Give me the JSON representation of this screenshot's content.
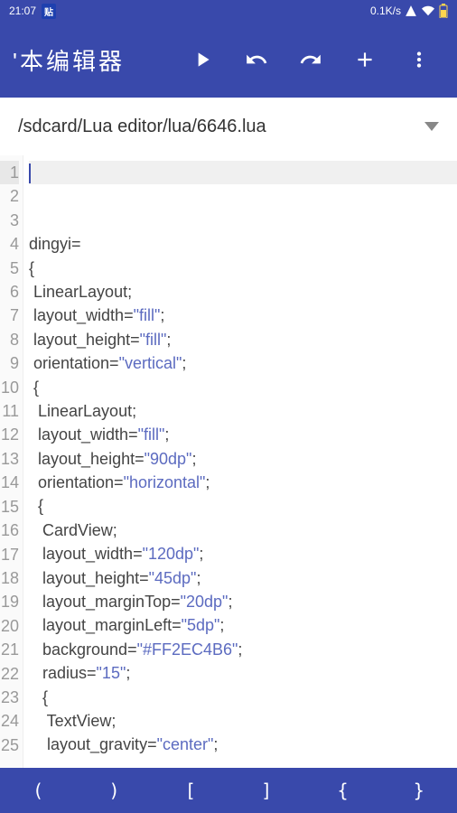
{
  "status": {
    "time": "21:07",
    "badge": "贴",
    "network_speed": "0.1K/s"
  },
  "toolbar": {
    "title": "'本编辑器"
  },
  "path": "/sdcard/Lua editor/lua/6646.lua",
  "code": {
    "lines": [
      {
        "n": 1,
        "highlight": true,
        "tokens": []
      },
      {
        "n": 2,
        "tokens": []
      },
      {
        "n": 3,
        "tokens": []
      },
      {
        "n": 4,
        "tokens": [
          {
            "t": "dingyi="
          }
        ]
      },
      {
        "n": 5,
        "tokens": [
          {
            "t": "{"
          }
        ]
      },
      {
        "n": 6,
        "tokens": [
          {
            "t": " LinearLayout;"
          }
        ]
      },
      {
        "n": 7,
        "tokens": [
          {
            "t": " layout_width="
          },
          {
            "t": "\"fill\"",
            "c": "str"
          },
          {
            "t": ";"
          }
        ]
      },
      {
        "n": 8,
        "tokens": [
          {
            "t": " layout_height="
          },
          {
            "t": "\"fill\"",
            "c": "str"
          },
          {
            "t": ";"
          }
        ]
      },
      {
        "n": 9,
        "tokens": [
          {
            "t": " orientation="
          },
          {
            "t": "\"vertical\"",
            "c": "str"
          },
          {
            "t": ";"
          }
        ]
      },
      {
        "n": 10,
        "tokens": [
          {
            "t": " {"
          }
        ]
      },
      {
        "n": 11,
        "tokens": [
          {
            "t": "  LinearLayout;"
          }
        ]
      },
      {
        "n": 12,
        "tokens": [
          {
            "t": "  layout_width="
          },
          {
            "t": "\"fill\"",
            "c": "str"
          },
          {
            "t": ";"
          }
        ]
      },
      {
        "n": 13,
        "tokens": [
          {
            "t": "  layout_height="
          },
          {
            "t": "\"90dp\"",
            "c": "str"
          },
          {
            "t": ";"
          }
        ]
      },
      {
        "n": 14,
        "tokens": [
          {
            "t": "  orientation="
          },
          {
            "t": "\"horizontal\"",
            "c": "str"
          },
          {
            "t": ";"
          }
        ]
      },
      {
        "n": 15,
        "tokens": [
          {
            "t": "  {"
          }
        ]
      },
      {
        "n": 16,
        "tokens": [
          {
            "t": "   CardView;"
          }
        ]
      },
      {
        "n": 17,
        "tokens": [
          {
            "t": "   layout_width="
          },
          {
            "t": "\"120dp\"",
            "c": "str"
          },
          {
            "t": ";"
          }
        ]
      },
      {
        "n": 18,
        "tokens": [
          {
            "t": "   layout_height="
          },
          {
            "t": "\"45dp\"",
            "c": "str"
          },
          {
            "t": ";"
          }
        ]
      },
      {
        "n": 19,
        "tokens": [
          {
            "t": "   layout_marginTop="
          },
          {
            "t": "\"20dp\"",
            "c": "str"
          },
          {
            "t": ";"
          }
        ]
      },
      {
        "n": 20,
        "tokens": [
          {
            "t": "   layout_marginLeft="
          },
          {
            "t": "\"5dp\"",
            "c": "str"
          },
          {
            "t": ";"
          }
        ]
      },
      {
        "n": 21,
        "tokens": [
          {
            "t": "   background="
          },
          {
            "t": "\"#FF2EC4B6\"",
            "c": "str"
          },
          {
            "t": ";"
          }
        ]
      },
      {
        "n": 22,
        "tokens": [
          {
            "t": "   radius="
          },
          {
            "t": "\"15\"",
            "c": "str"
          },
          {
            "t": ";"
          }
        ]
      },
      {
        "n": 23,
        "tokens": [
          {
            "t": "   {"
          }
        ]
      },
      {
        "n": 24,
        "tokens": [
          {
            "t": "    TextView;"
          }
        ]
      },
      {
        "n": 25,
        "tokens": [
          {
            "t": "    layout_gravity="
          },
          {
            "t": "\"center\"",
            "c": "str"
          },
          {
            "t": ";"
          }
        ]
      }
    ]
  },
  "brackets": [
    "(",
    ")",
    "[",
    "]",
    "{",
    "}"
  ]
}
